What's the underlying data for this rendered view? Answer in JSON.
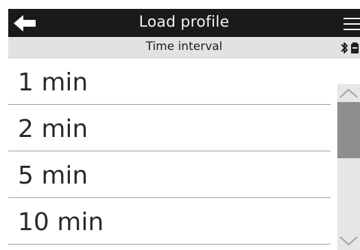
{
  "header": {
    "title": "Load profile",
    "back_icon": "arrow-left-icon",
    "menu_icon": "hamburger-menu-icon"
  },
  "subheader": {
    "title": "Time interval",
    "status_icons": [
      "bluetooth-icon",
      "battery-icon"
    ]
  },
  "list": {
    "items": [
      {
        "label": "1 min"
      },
      {
        "label": "2 min"
      },
      {
        "label": "5 min"
      },
      {
        "label": "10 min"
      }
    ]
  },
  "scrollbar": {
    "up_icon": "chevron-up-icon",
    "down_icon": "chevron-down-icon",
    "thumb_fraction": 0.34,
    "position_fraction": 0.0
  },
  "colors": {
    "header_bg": "#1a1a1a",
    "subheader_bg": "#e2e2e2",
    "text": "#2a2a2a",
    "divider": "#9a9a9a",
    "scroll_track": "#e6e6e6",
    "scroll_thumb": "#8e8e8e"
  }
}
